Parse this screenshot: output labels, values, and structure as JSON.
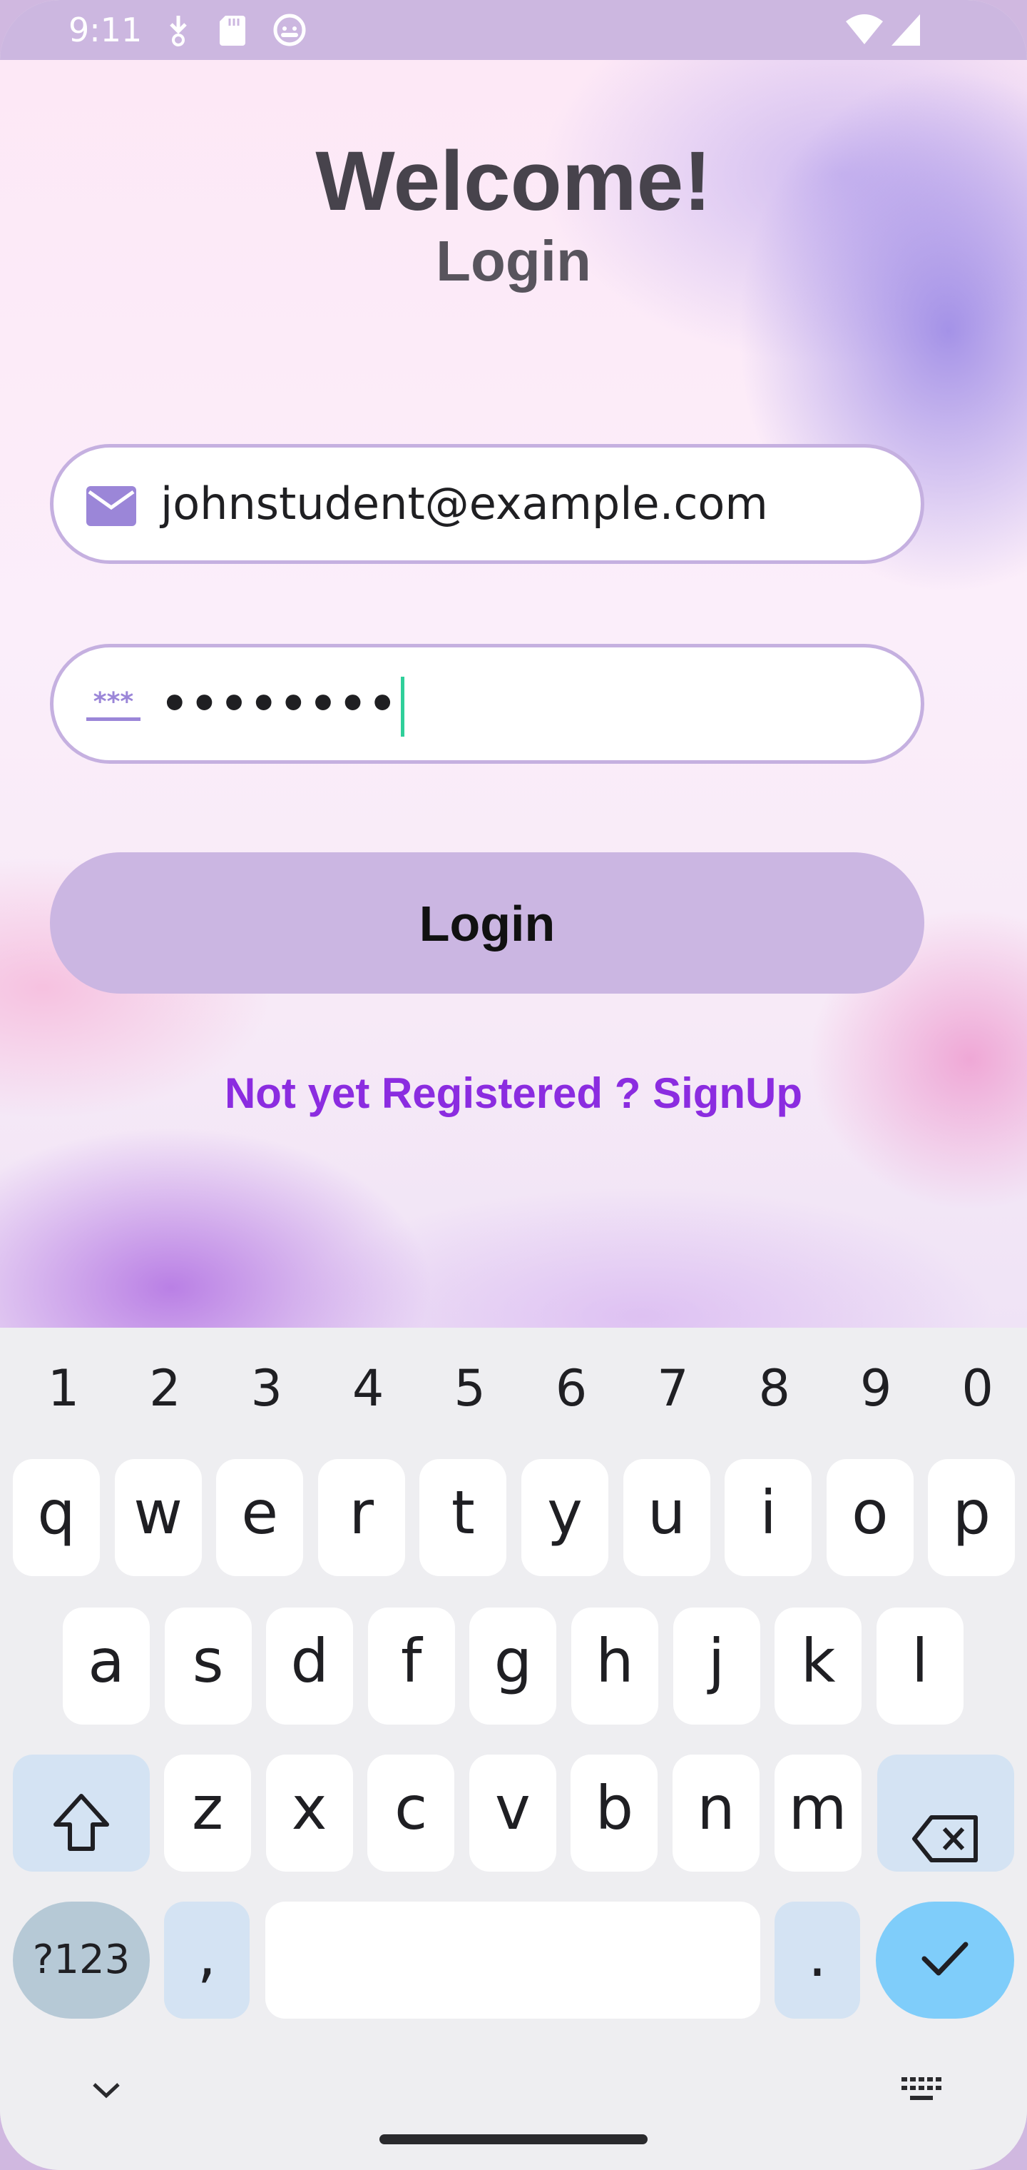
{
  "status_bar": {
    "time": "9:11"
  },
  "login_screen": {
    "welcome_title": "Welcome!",
    "subtitle": "Login",
    "email": {
      "value": "johnstudent@example.com",
      "icon": "mail-icon"
    },
    "password": {
      "value": "••••••••",
      "icon": "password-icon"
    },
    "login_button_label": "Login",
    "signup_link": "Not yet Registered ? SignUp"
  },
  "keyboard": {
    "number_row": [
      "1",
      "2",
      "3",
      "4",
      "5",
      "6",
      "7",
      "8",
      "9",
      "0"
    ],
    "row1": [
      "q",
      "w",
      "e",
      "r",
      "t",
      "y",
      "u",
      "i",
      "o",
      "p"
    ],
    "row2": [
      "a",
      "s",
      "d",
      "f",
      "g",
      "h",
      "j",
      "k",
      "l"
    ],
    "row3": [
      "z",
      "x",
      "c",
      "v",
      "b",
      "n",
      "m"
    ],
    "symbols_label": "?123",
    "comma_label": ",",
    "period_label": ".",
    "icons": [
      "shift-icon",
      "backspace-icon",
      "check-icon",
      "chevron-down-icon",
      "keyboard-icon"
    ]
  },
  "colors": {
    "accent": "#8b2ce0",
    "button": "#cbb6e2",
    "field_border": "#c5b0e0",
    "enter_key": "#7fcdfa"
  }
}
